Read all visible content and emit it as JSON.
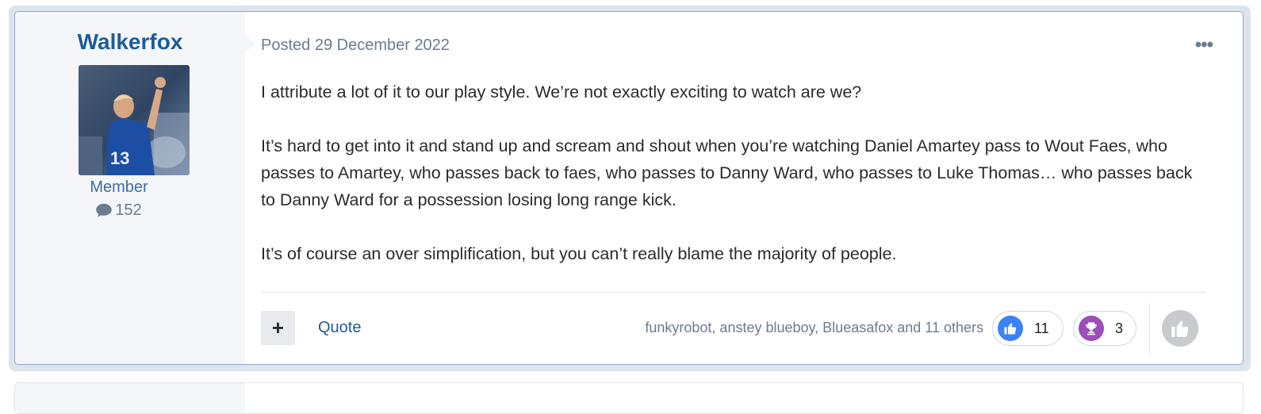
{
  "author": {
    "name": "Walkerfox",
    "group": "Member",
    "post_count": "152"
  },
  "post": {
    "posted": "Posted 29 December 2022",
    "paragraphs": [
      "I attribute a lot of it to our play style. We’re not exactly exciting to watch are we?",
      "It’s hard to get into it and stand up and scream and shout when you’re watching Daniel Amartey pass to Wout Faes, who passes to Amartey, who passes back to faes, who passes to Danny Ward, who passes to Luke Thomas… who passes back to Danny Ward for a possession losing long range kick.",
      "It’s of course an over simplification, but you can’t really blame the majority of people."
    ]
  },
  "actions": {
    "multiquote_label": "+",
    "quote_label": "Quote",
    "more_label": "•••"
  },
  "reactions": {
    "summary": "funkyrobot, anstey blueboy, Blueasafox and 11 others",
    "items": [
      {
        "type": "like",
        "count": "11",
        "color": "#3b82f6",
        "icon": "thumbs-up-icon"
      },
      {
        "type": "trophy",
        "count": "3",
        "color": "#9b4fb8",
        "icon": "trophy-icon"
      }
    ]
  },
  "colors": {
    "accent": "#1f5b9c",
    "post_border": "#8fa9c8",
    "author_bg": "#f4f6f9"
  }
}
